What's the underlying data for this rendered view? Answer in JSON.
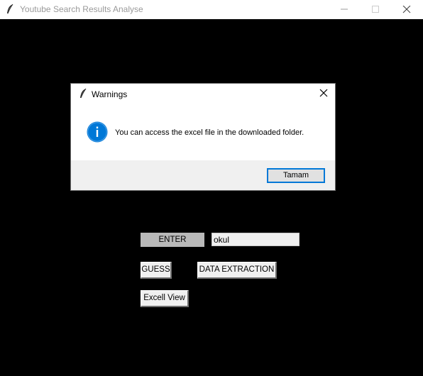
{
  "window": {
    "title": "Youtube Search Results Analyse"
  },
  "dialog": {
    "title": "Warnings",
    "message": "You can access the excel file in the downloaded folder.",
    "ok_label": "Tamam"
  },
  "form": {
    "subject_label": "ENTER SUBJECT:",
    "subject_value": "okul",
    "guess_label": "GUESS",
    "extract_label": "DATA EXTRACTION",
    "excel_label": "Excell View"
  },
  "colors": {
    "background": "#000000",
    "info_icon": "#0078d7",
    "focus_border": "#0078d7"
  },
  "icons": [
    "feather-icon",
    "minimize-icon",
    "maximize-icon",
    "close-icon",
    "info-icon"
  ]
}
